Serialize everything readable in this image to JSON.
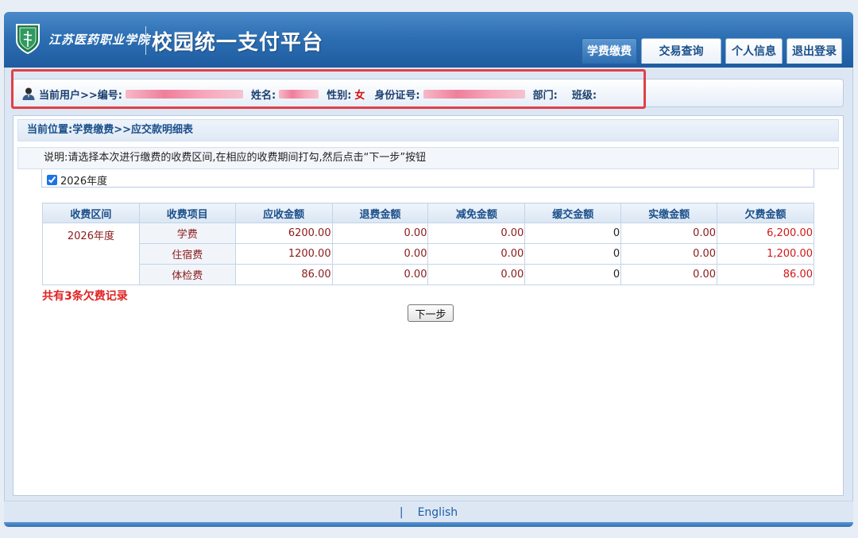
{
  "header": {
    "school_name": "江苏医药职业学院",
    "platform_title": "校园统一支付平台",
    "nav": [
      {
        "label": "学费缴费",
        "active": true
      },
      {
        "label": "交易查询",
        "active": false
      },
      {
        "label": "个人信息",
        "active": false
      },
      {
        "label": "退出登录",
        "active": false
      }
    ]
  },
  "user": {
    "prefix": "当前用户>>编号:",
    "name_label": "姓名:",
    "gender_label": "性别:",
    "gender_value": "女",
    "id_label": "身份证号:",
    "dept_label": "部门:",
    "class_label": "班级:"
  },
  "breadcrumb": "当前位置:学费缴费>>应交款明细表",
  "notice": "说明:请选择本次进行缴费的收费区间,在相应的收费期间打勾,然后点击“下一步”按钮",
  "period_option": {
    "label": "2026年度",
    "checked": true
  },
  "table": {
    "headers": [
      "收费区间",
      "收费项目",
      "应收金额",
      "退费金额",
      "减免金额",
      "缓交金额",
      "实缴金额",
      "欠费金额"
    ],
    "period": "2026年度",
    "rows": [
      {
        "item": "学费",
        "receivable": "6200.00",
        "refund": "0.00",
        "reduction": "0.00",
        "deferred": "0",
        "paid": "0.00",
        "owed": "6,200.00"
      },
      {
        "item": "住宿费",
        "receivable": "1200.00",
        "refund": "0.00",
        "reduction": "0.00",
        "deferred": "0",
        "paid": "0.00",
        "owed": "1,200.00"
      },
      {
        "item": "体检费",
        "receivable": "86.00",
        "refund": "0.00",
        "reduction": "0.00",
        "deferred": "0",
        "paid": "0.00",
        "owed": "86.00"
      }
    ]
  },
  "total_message": "共有3条欠费记录",
  "next_button": "下一步",
  "footer": {
    "separator": "|",
    "language_link": "English"
  },
  "colors": {
    "header_blue": "#2d6fb3",
    "highlight_red": "#e04048",
    "owed_red": "#d01818"
  }
}
